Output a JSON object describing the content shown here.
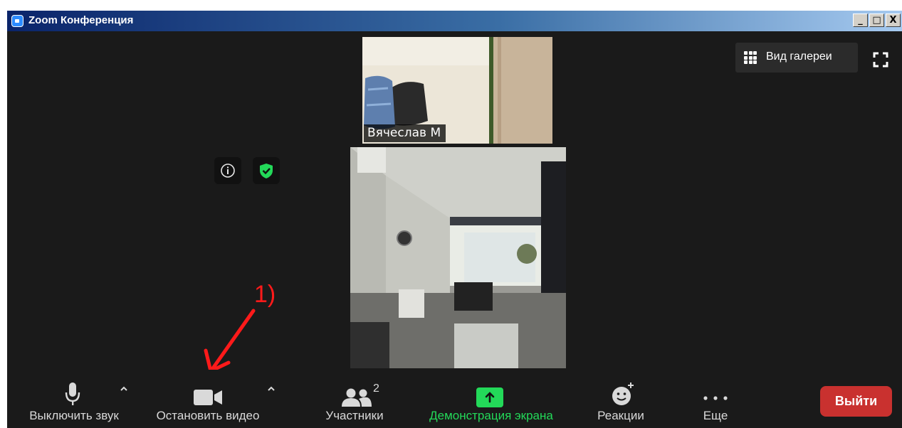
{
  "window": {
    "title": "Zoom Конференция",
    "minimize": "_",
    "maximize": "□",
    "close": "X"
  },
  "header": {
    "gallery_view_label": "Вид галереи"
  },
  "participants_tiles": [
    {
      "name": "Вячеслав М"
    }
  ],
  "annotation": {
    "label": "1)",
    "color": "#ff1a1a"
  },
  "toolbar": {
    "mute_label": "Выключить звук",
    "stop_video_label": "Остановить видео",
    "participants_label": "Участники",
    "participants_count": "2",
    "share_screen_label": "Демонстрация экрана",
    "reactions_label": "Реакции",
    "more_label": "Еще",
    "leave_label": "Выйти"
  },
  "colors": {
    "share_green": "#23d959",
    "leave_red": "#c9312f",
    "shield_green": "#23d959"
  }
}
